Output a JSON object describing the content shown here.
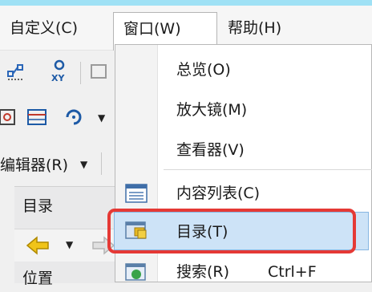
{
  "menubar": {
    "items": [
      {
        "label": "自定义(C)"
      },
      {
        "label": "窗口(W)"
      },
      {
        "label": "帮助(H)"
      }
    ]
  },
  "toolbar": {
    "editor_label": "编辑器(R)"
  },
  "catalog_panel": {
    "title": "目录",
    "bottom_label": "位置"
  },
  "window_menu": {
    "items": [
      {
        "label": "总览(O)",
        "icon": "none"
      },
      {
        "label": "放大镜(M)",
        "icon": "none"
      },
      {
        "label": "查看器(V)",
        "icon": "none"
      },
      {
        "label": "内容列表(C)",
        "icon": "table-of-contents-icon"
      },
      {
        "label": "目录(T)",
        "icon": "catalog-icon",
        "highlighted": true
      },
      {
        "label": "搜索(R)",
        "shortcut": "Ctrl+F",
        "icon": "search-window-icon"
      }
    ]
  },
  "colors": {
    "highlight": "#cde3f7",
    "annotation_red": "#e53935"
  }
}
